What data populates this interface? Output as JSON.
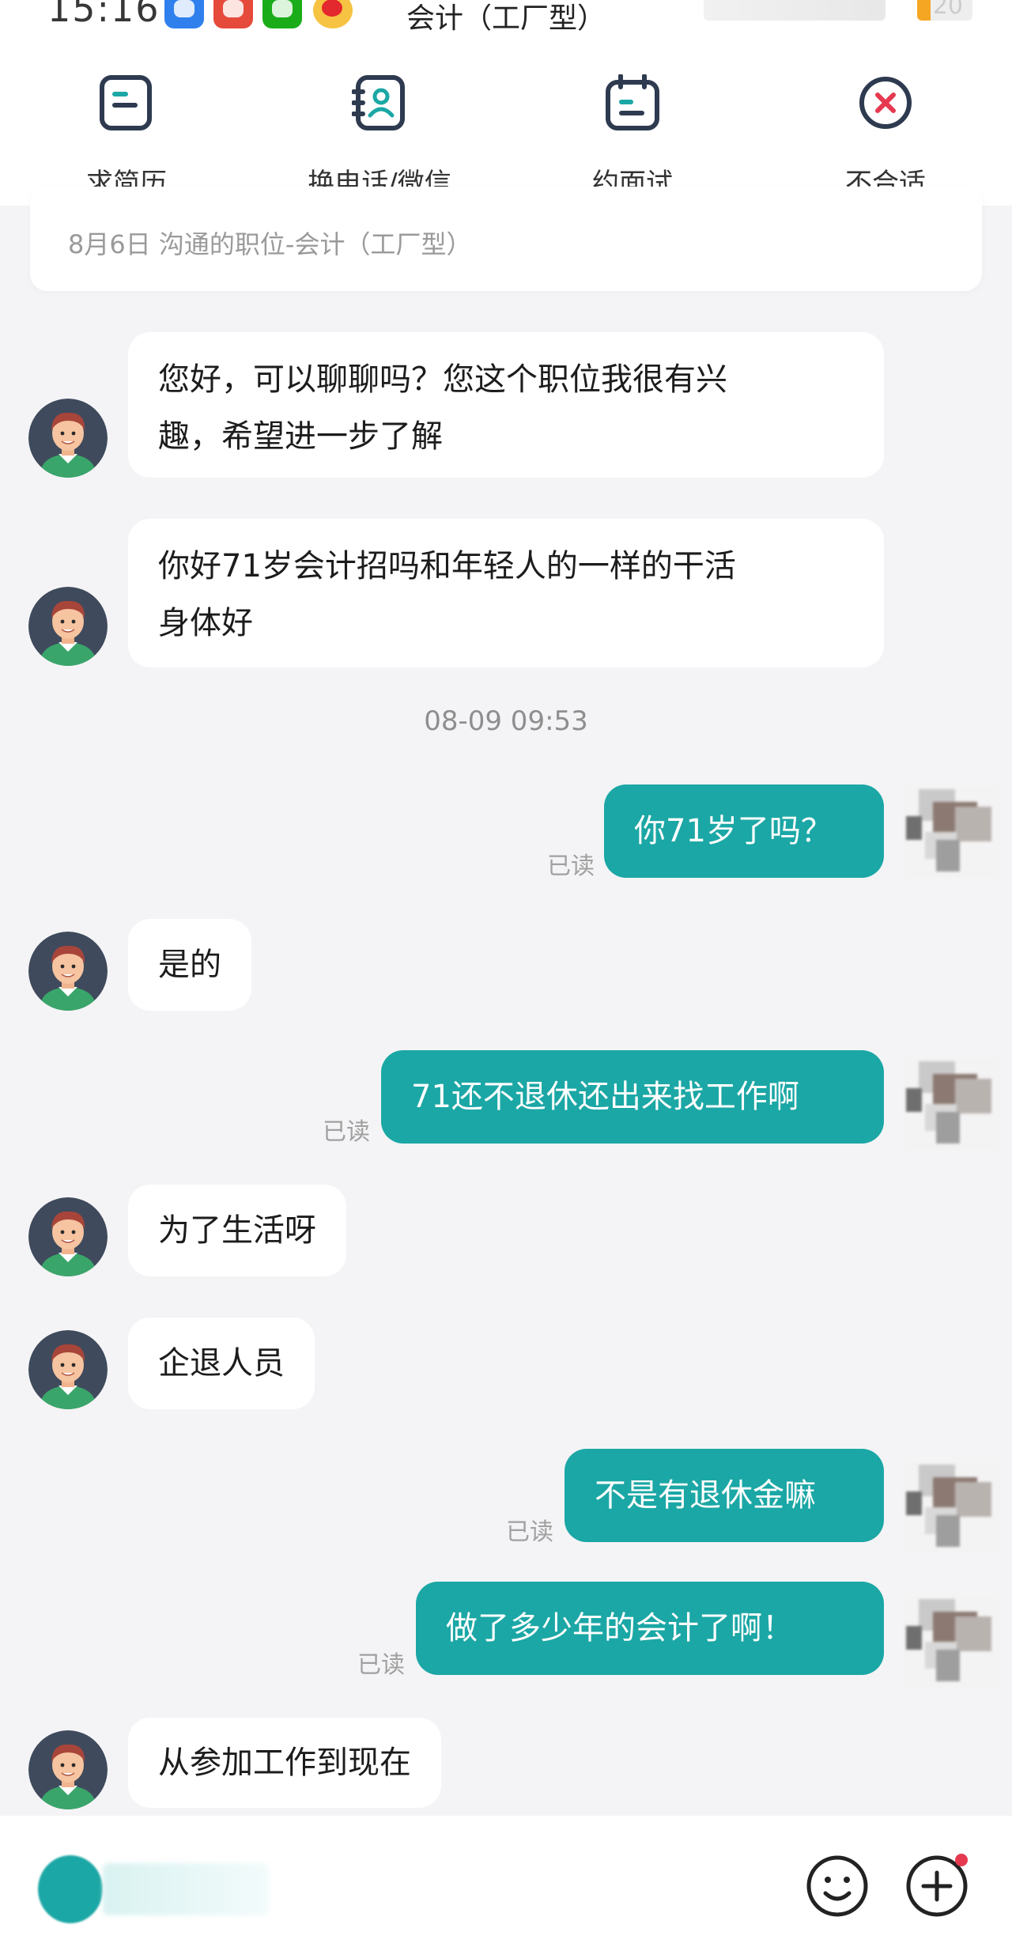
{
  "status_bar": {
    "time": "15:16",
    "battery": "20"
  },
  "header": {
    "title": "会计（工厂型）"
  },
  "actions": [
    {
      "label": "求简历",
      "icon": "resume-icon"
    },
    {
      "label": "换电话/微信",
      "icon": "contact-exchange-icon"
    },
    {
      "label": "约面试",
      "icon": "calendar-icon"
    },
    {
      "label": "不合适",
      "icon": "reject-icon"
    }
  ],
  "job_info": {
    "text": "8月6日 沟通的职位-会计（工厂型）"
  },
  "messages": [
    {
      "from": "them",
      "lines": [
        "您好，可以聊聊吗？您这个职位我很有兴",
        "趣，希望进一步了解"
      ]
    },
    {
      "from": "them",
      "lines": [
        "你好71岁会计招吗和年轻人的一样的干活",
        "身体好"
      ]
    },
    {
      "timestamp": "08-09 09:53"
    },
    {
      "from": "me",
      "text": "你71岁了吗？",
      "status": "已读"
    },
    {
      "from": "them",
      "text": "是的"
    },
    {
      "from": "me",
      "text": "71还不退休还出来找工作啊",
      "status": "已读"
    },
    {
      "from": "them",
      "text": "为了生活呀"
    },
    {
      "from": "them",
      "text": "企退人员"
    },
    {
      "from": "me",
      "text": "不是有退休金嘛",
      "status": "已读"
    },
    {
      "from": "me",
      "text": "做了多少年的会计了啊！",
      "status": "已读"
    },
    {
      "from": "them",
      "text": "从参加工作到现在"
    }
  ],
  "colors": {
    "accent": "#1ba7a5",
    "reject": "#e53950",
    "background": "#f4f4f6"
  },
  "input_bar": {
    "emoji_icon": "emoji-icon",
    "plus_icon": "plus-icon"
  }
}
